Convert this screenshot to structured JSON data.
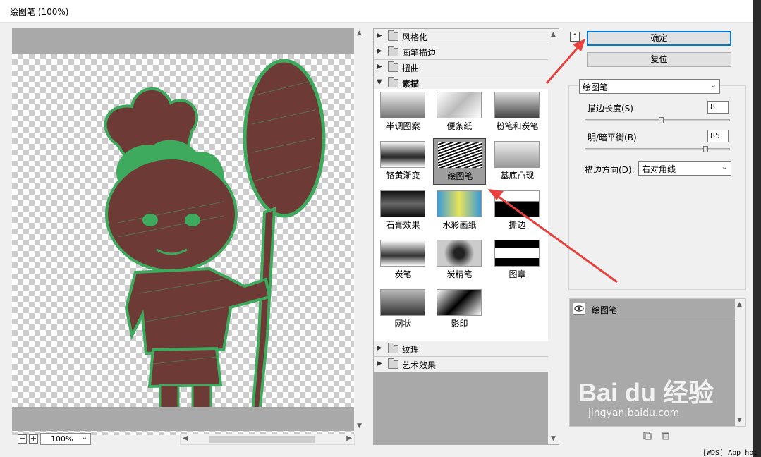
{
  "window": {
    "title": "绘图笔 (100%)"
  },
  "preview": {
    "zoom": "100%"
  },
  "categories": {
    "top": [
      {
        "label": "风格化"
      },
      {
        "label": "画笔描边"
      },
      {
        "label": "扭曲"
      },
      {
        "label": "素描"
      }
    ],
    "bottom": [
      {
        "label": "纹理"
      },
      {
        "label": "艺术效果"
      }
    ]
  },
  "filters": [
    {
      "label": "半调图案"
    },
    {
      "label": "便条纸"
    },
    {
      "label": "粉笔和炭笔"
    },
    {
      "label": "铬黄渐变"
    },
    {
      "label": "绘图笔"
    },
    {
      "label": "基底凸现"
    },
    {
      "label": "石膏效果"
    },
    {
      "label": "水彩画纸"
    },
    {
      "label": "撕边"
    },
    {
      "label": "炭笔"
    },
    {
      "label": "炭精笔"
    },
    {
      "label": "图章"
    },
    {
      "label": "网状"
    },
    {
      "label": "影印"
    }
  ],
  "buttons": {
    "ok": "确定",
    "reset": "复位"
  },
  "settings": {
    "filter_select": "绘图笔",
    "stroke_length": {
      "label": "描边长度(S)",
      "value": "8",
      "level": 0.53
    },
    "light_dark": {
      "label": "明/暗平衡(B)",
      "value": "85",
      "level": 0.85
    },
    "direction": {
      "label": "描边方向(D):",
      "value": "右对角线"
    }
  },
  "layers": {
    "items": [
      {
        "name": "绘图笔"
      }
    ]
  },
  "watermark": {
    "brand": "Bai du 经验",
    "sub": "jingyan.baidu.com"
  },
  "status": "[WDS] App hot",
  "colors": {
    "accent": "#0078d7",
    "annotation": "#e8403c",
    "figure_fill": "#6e3a36",
    "figure_outline": "#3daa5e"
  }
}
